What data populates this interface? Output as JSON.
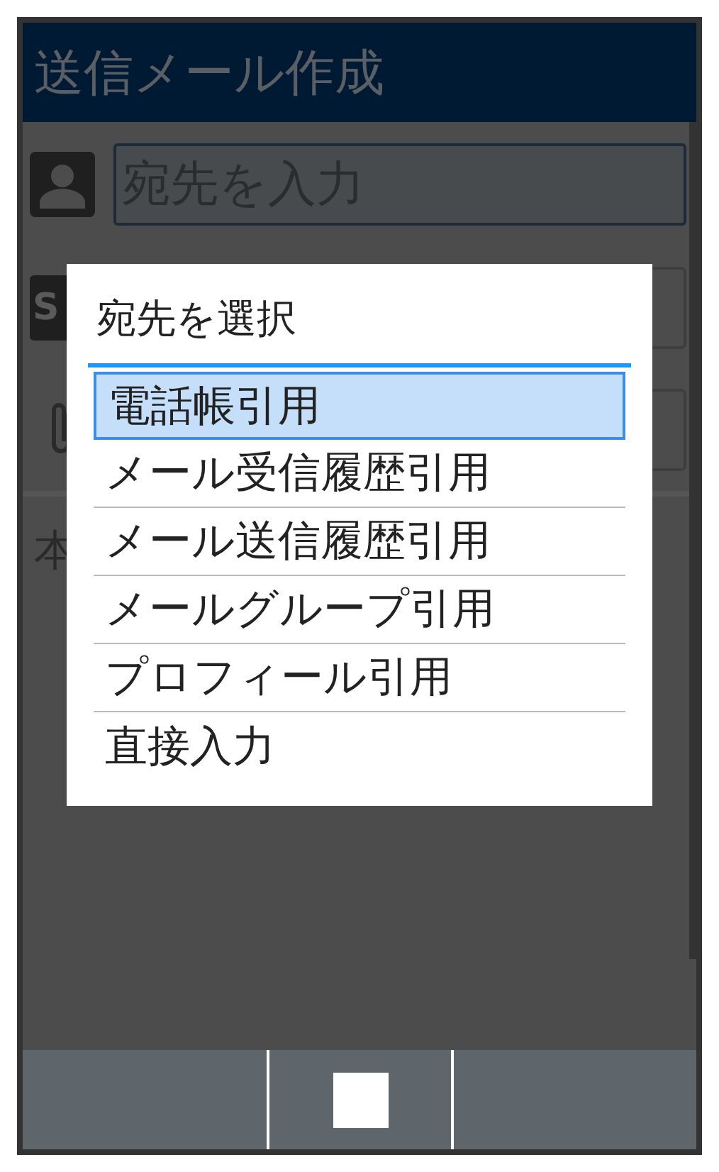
{
  "title_bar": {
    "title": "送信メール作成"
  },
  "to_row": {
    "placeholder": "宛先を入力"
  },
  "subject_row": {
    "icon_text": "S"
  },
  "body": {
    "text": "本"
  },
  "dialog": {
    "title": "宛先を選択",
    "items": [
      {
        "label": "電話帳引用",
        "selected": true
      },
      {
        "label": "メール受信履歴引用",
        "selected": false
      },
      {
        "label": "メール送信履歴引用",
        "selected": false
      },
      {
        "label": "メールグループ引用",
        "selected": false
      },
      {
        "label": "プロフィール引用",
        "selected": false
      },
      {
        "label": "直接入力",
        "selected": false
      }
    ]
  }
}
